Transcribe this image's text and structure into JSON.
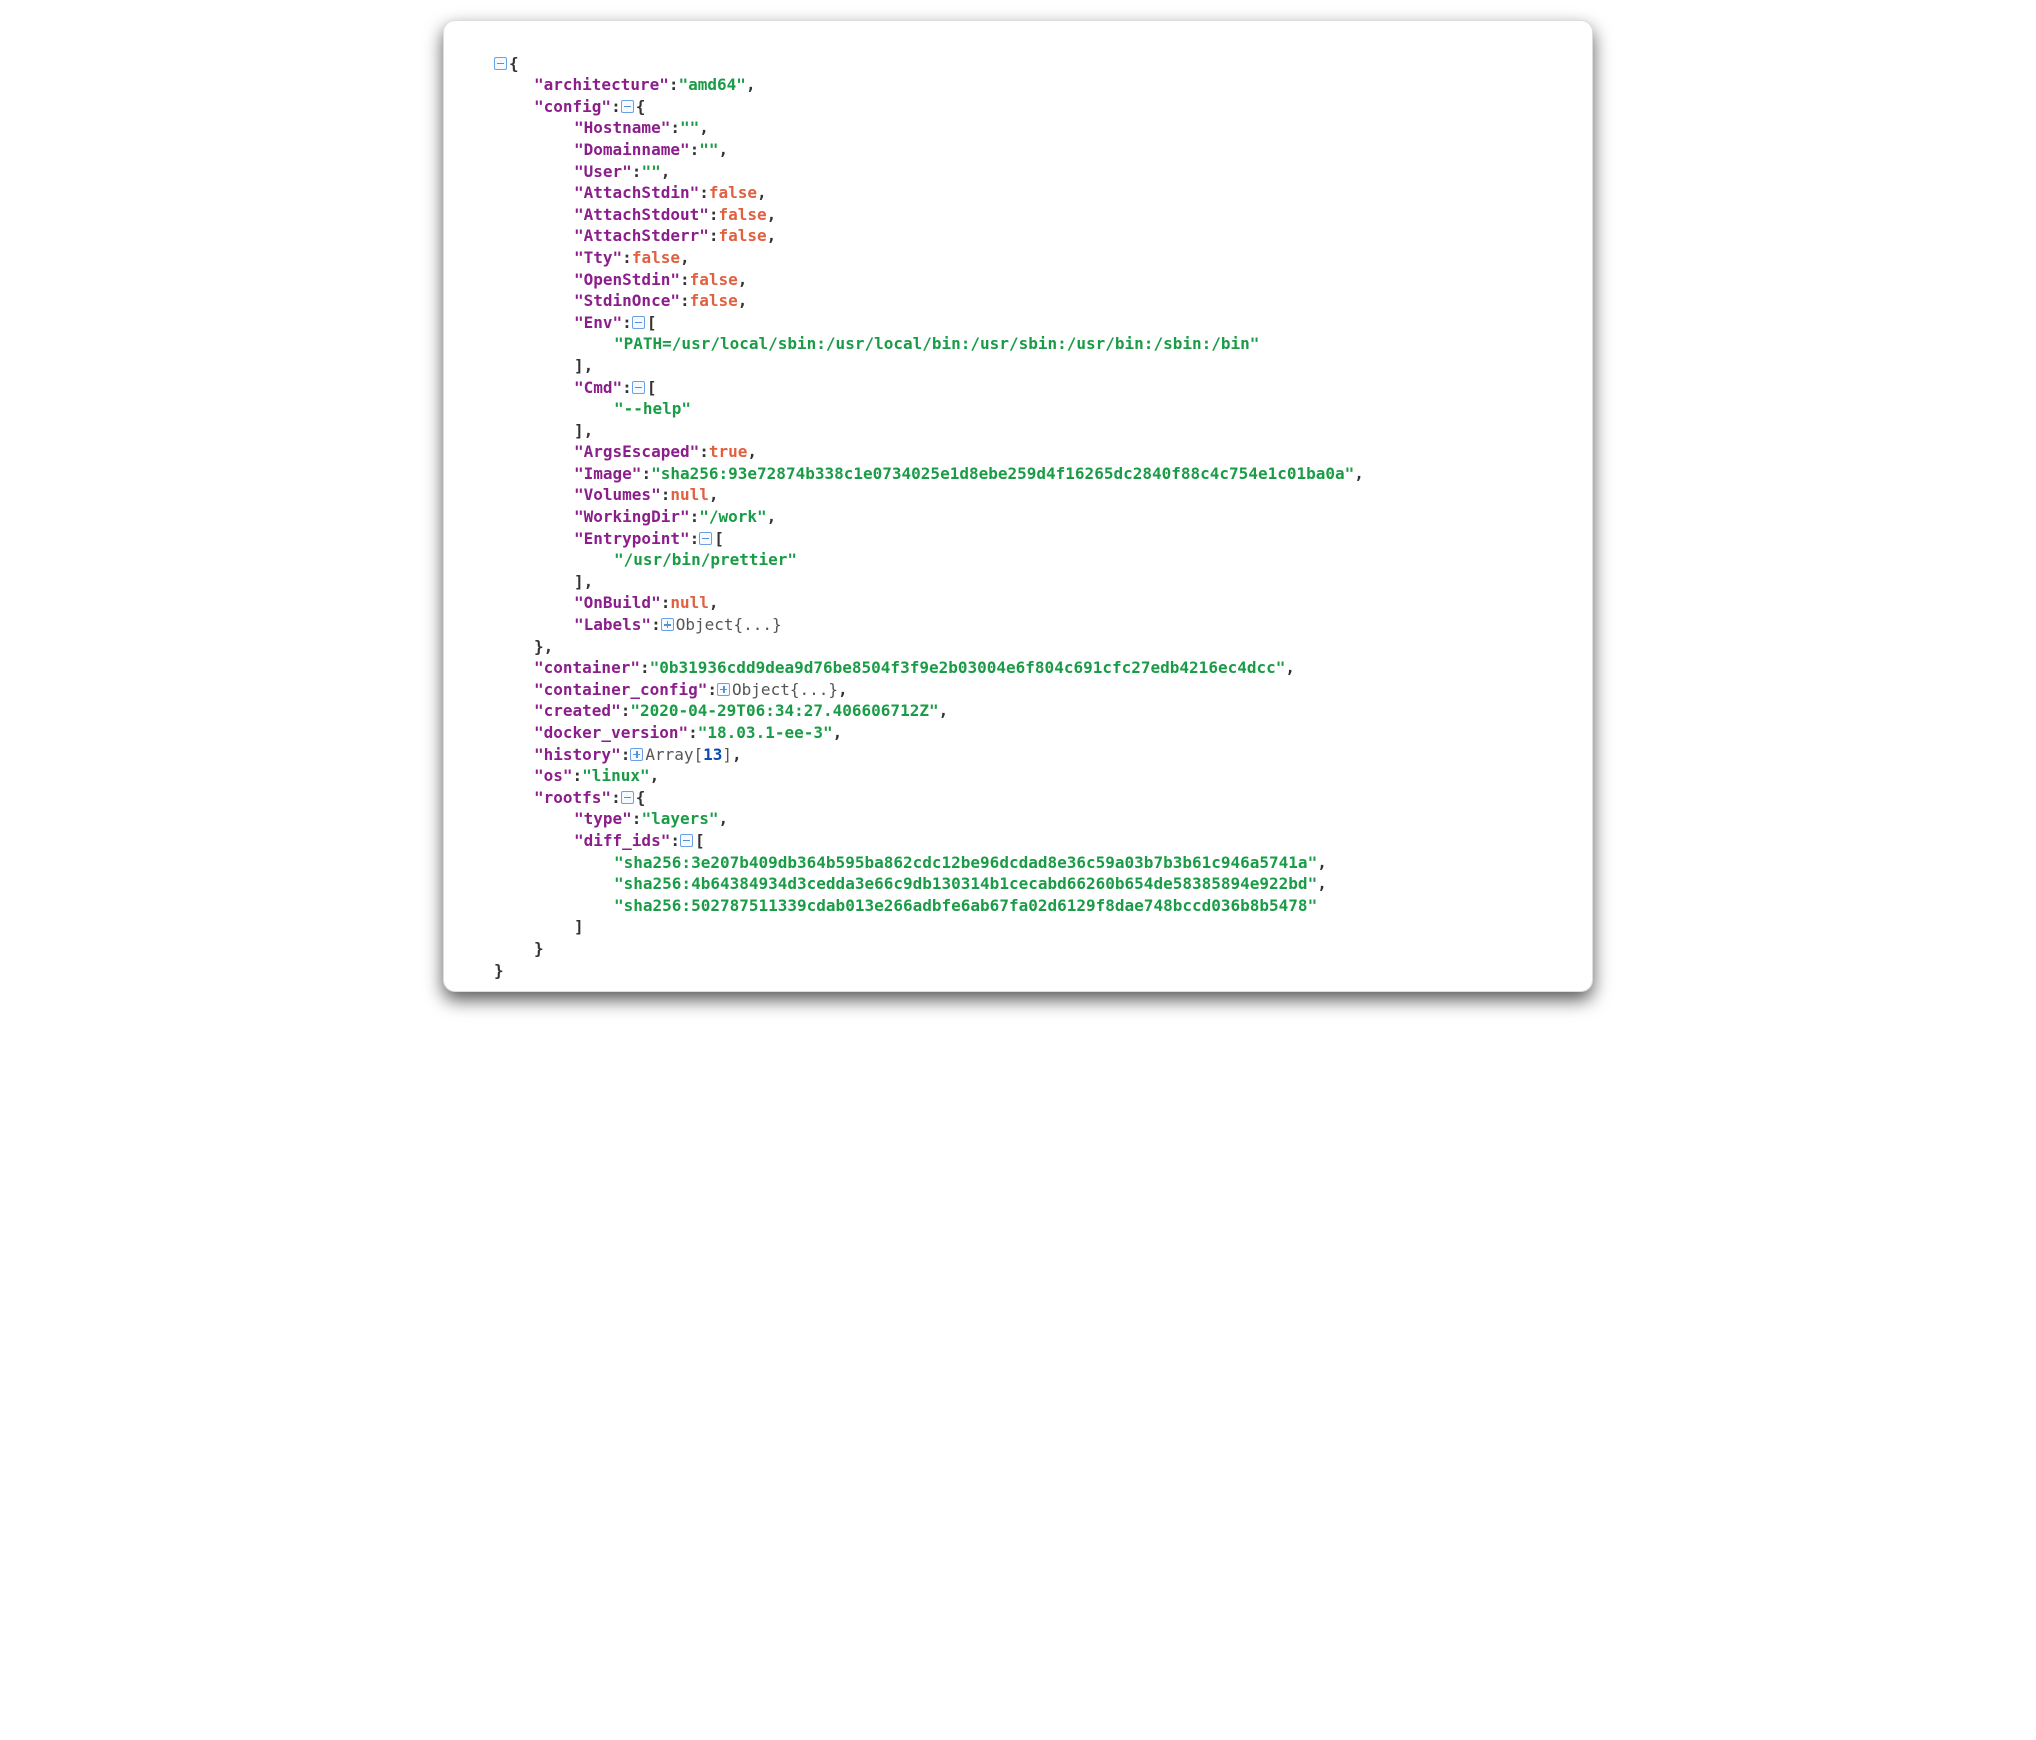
{
  "root": {
    "architecture_key": "\"architecture\"",
    "architecture_val": "\"amd64\"",
    "config_key": "\"config\"",
    "config": {
      "hostname_key": "\"Hostname\"",
      "hostname_val": "\"\"",
      "domainname_key": "\"Domainname\"",
      "domainname_val": "\"\"",
      "user_key": "\"User\"",
      "user_val": "\"\"",
      "attach_stdin_key": "\"AttachStdin\"",
      "attach_stdin_val": "false",
      "attach_stdout_key": "\"AttachStdout\"",
      "attach_stdout_val": "false",
      "attach_stderr_key": "\"AttachStderr\"",
      "attach_stderr_val": "false",
      "tty_key": "\"Tty\"",
      "tty_val": "false",
      "open_stdin_key": "\"OpenStdin\"",
      "open_stdin_val": "false",
      "stdin_once_key": "\"StdinOnce\"",
      "stdin_once_val": "false",
      "env_key": "\"Env\"",
      "env_items": [
        "\"PATH=/usr/local/sbin:/usr/local/bin:/usr/sbin:/usr/bin:/sbin:/bin\""
      ],
      "cmd_key": "\"Cmd\"",
      "cmd_items": [
        "\"--help\""
      ],
      "args_escaped_key": "\"ArgsEscaped\"",
      "args_escaped_val": "true",
      "image_key": "\"Image\"",
      "image_val": "\"sha256:93e72874b338c1e0734025e1d8ebe259d4f16265dc2840f88c4c754e1c01ba0a\"",
      "volumes_key": "\"Volumes\"",
      "volumes_val": "null",
      "working_dir_key": "\"WorkingDir\"",
      "working_dir_val": "\"/work\"",
      "entrypoint_key": "\"Entrypoint\"",
      "entrypoint_items": [
        "\"/usr/bin/prettier\""
      ],
      "onbuild_key": "\"OnBuild\"",
      "onbuild_val": "null",
      "labels_key": "\"Labels\"",
      "labels_collapsed": "Object{...}"
    },
    "container_key": "\"container\"",
    "container_val": "\"0b31936cdd9dea9d76be8504f3f9e2b03004e6f804c691cfc27edb4216ec4dcc\"",
    "container_config_key": "\"container_config\"",
    "container_config_collapsed": "Object{...}",
    "created_key": "\"created\"",
    "created_val": "\"2020-04-29T06:34:27.406606712Z\"",
    "docker_version_key": "\"docker_version\"",
    "docker_version_val": "\"18.03.1-ee-3\"",
    "history_key": "\"history\"",
    "history_collapsed_prefix": "Array[",
    "history_collapsed_count": "13",
    "history_collapsed_suffix": "]",
    "os_key": "\"os\"",
    "os_val": "\"linux\"",
    "rootfs_key": "\"rootfs\"",
    "rootfs": {
      "type_key": "\"type\"",
      "type_val": "\"layers\"",
      "diff_ids_key": "\"diff_ids\"",
      "diff_ids_items": [
        "\"sha256:3e207b409db364b595ba862cdc12be96dcdad8e36c59a03b7b3b61c946a5741a\"",
        "\"sha256:4b64384934d3cedda3e66c9db130314b1cecabd66260b654de58385894e922bd\"",
        "\"sha256:502787511339cdab013e266adbfe6ab67fa02d6129f8dae748bccd036b8b5478\""
      ]
    }
  }
}
